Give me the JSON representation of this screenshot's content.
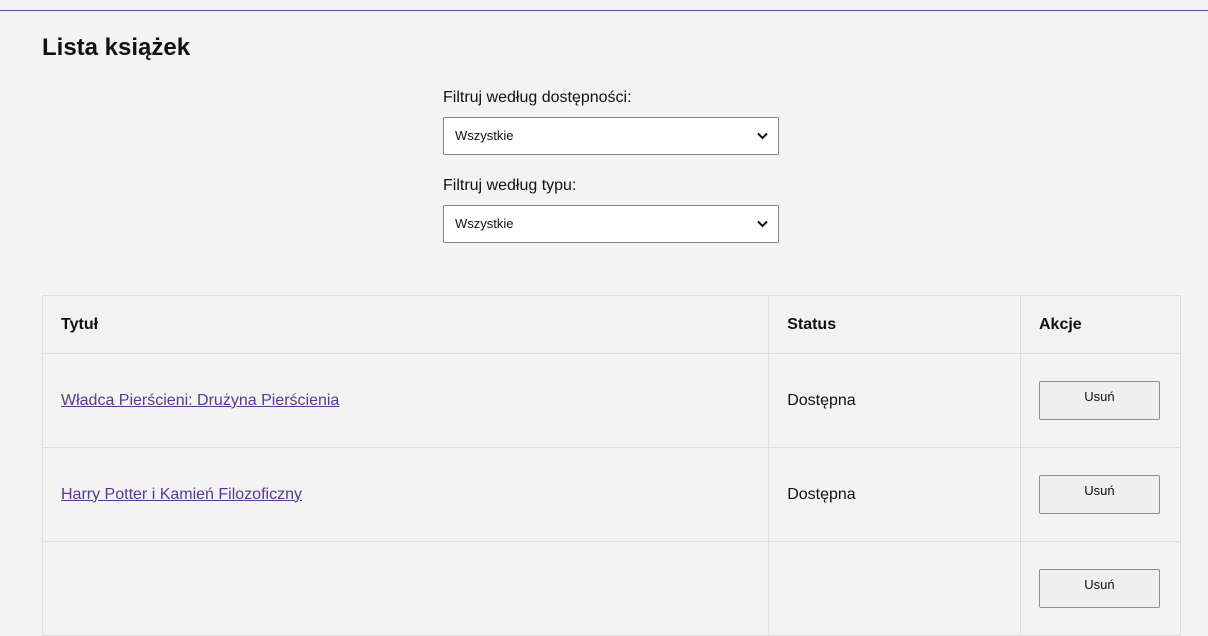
{
  "page": {
    "title": "Lista książek"
  },
  "filters": {
    "availability": {
      "label": "Filtruj według dostępności:",
      "selected": "Wszystkie"
    },
    "type": {
      "label": "Filtruj według typu:",
      "selected": "Wszystkie"
    }
  },
  "table": {
    "headers": {
      "title": "Tytuł",
      "status": "Status",
      "actions": "Akcje"
    },
    "rows": [
      {
        "title": "Władca Pierścieni: Drużyna Pierścienia",
        "status": "Dostępna",
        "action": "Usuń"
      },
      {
        "title": "Harry Potter i Kamień Filozoficzny",
        "status": "Dostępna",
        "action": "Usuń"
      },
      {
        "title": "",
        "status": "",
        "action": "Usuń"
      }
    ]
  },
  "colors": {
    "accent_line": "#5b4a9e",
    "link": "#5a3a8c",
    "background": "#f3f3f3"
  },
  "icons": {
    "select_arrow": "chevron-down-icon"
  }
}
